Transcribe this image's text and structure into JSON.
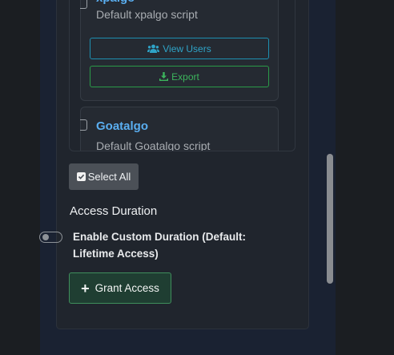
{
  "scripts": [
    {
      "title": "xpalgo",
      "description": "Default xpalgo script",
      "view_users_label": "View Users",
      "export_label": "Export"
    },
    {
      "title": "Goatalgo",
      "description": "Default Goatalgo script"
    }
  ],
  "select_all_label": "Select All",
  "access_duration": {
    "heading": "Access Duration",
    "toggle_label": "Enable Custom Duration (Default: Lifetime Access)",
    "toggle_on": false
  },
  "grant_label": "Grant Access",
  "colors": {
    "accent_blue": "#5aaef0",
    "info": "#2fa4c8",
    "success": "#3cb45c"
  },
  "icons": [
    "users-icon",
    "download-icon",
    "checkbox-icon",
    "plus-icon"
  ]
}
